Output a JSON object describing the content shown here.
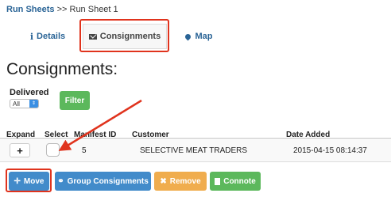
{
  "breadcrumb": {
    "root": "Run Sheets",
    "separator": ">>",
    "current": "Run Sheet 1"
  },
  "tabs": [
    {
      "label": "Details",
      "icon": "info-icon",
      "glyph": "i"
    },
    {
      "label": "Consignments",
      "icon": "envelope-icon"
    },
    {
      "label": "Map",
      "icon": "map-marker-icon"
    }
  ],
  "page": {
    "title": "Consignments:"
  },
  "filter": {
    "label": "Delivered",
    "selected": "All",
    "button": "Filter"
  },
  "table": {
    "headers": [
      "Expand",
      "Select",
      "Manifest ID",
      "Customer",
      "Date Added"
    ],
    "rows": [
      {
        "expand": "+",
        "manifest_id": "5",
        "customer": "SELECTIVE MEAT TRADERS",
        "date_added": "2015-04-15 08:14:37"
      }
    ]
  },
  "actions": {
    "move": {
      "label": "Move",
      "glyph": "✛"
    },
    "group": {
      "label": "Group Consignments",
      "glyph": "⚭"
    },
    "remove": {
      "label": "Remove",
      "glyph": "✖"
    },
    "connote": {
      "label": "Connote"
    }
  },
  "colors": {
    "primary": "#428bca",
    "success": "#5cb85c",
    "warning": "#f0ad4e",
    "link": "#2a6496",
    "annotation": "#e0331d"
  }
}
